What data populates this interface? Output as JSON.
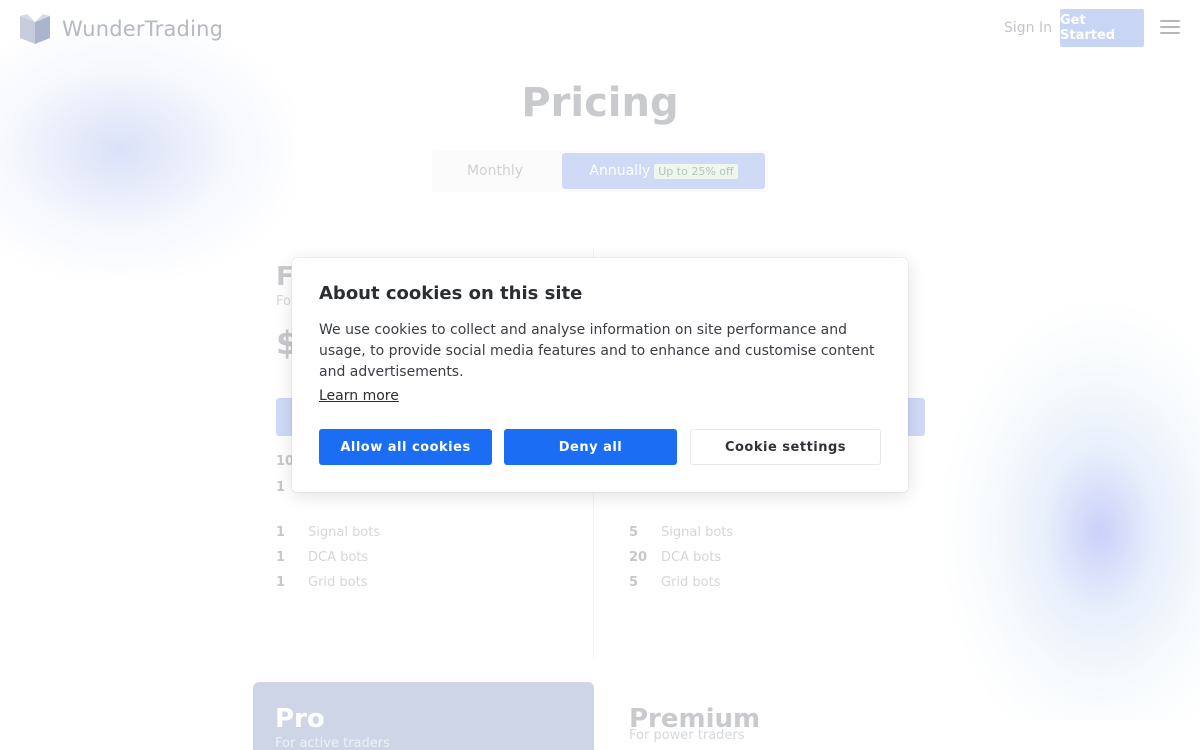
{
  "header": {
    "brand": "WunderTrading",
    "signin_label": "Sign In",
    "get_started_label": "Get Started"
  },
  "pricing": {
    "title": "Pricing",
    "toggle": {
      "monthly_label": "Monthly",
      "annually_label": "Annually",
      "discount_badge": "Up to 25% off",
      "selected": "Annually"
    }
  },
  "plans": {
    "free": {
      "name_partial": "F",
      "subtitle_partial": "Fo",
      "price_partial": "$",
      "features_partial": [
        {
          "count": "10"
        },
        {
          "count": "1"
        }
      ],
      "bots": [
        {
          "count": "1",
          "label": "Signal bots"
        },
        {
          "count": "1",
          "label": "DCA bots"
        },
        {
          "count": "1",
          "label": "Grid bots"
        }
      ]
    },
    "basic": {
      "bots": [
        {
          "count": "5",
          "label": "Signal bots"
        },
        {
          "count": "20",
          "label": "DCA bots"
        },
        {
          "count": "5",
          "label": "Grid bots"
        }
      ]
    },
    "pro": {
      "name": "Pro",
      "subtitle": "For active traders"
    },
    "premium": {
      "name": "Premium",
      "subtitle": "For power traders"
    }
  },
  "cookie_banner": {
    "title": "About cookies on this site",
    "body": "We use cookies to collect and analyse information on site performance and usage, to provide social media features and to enhance and customise content and advertisements.",
    "learn_more": "Learn more",
    "allow_label": "Allow all cookies",
    "deny_label": "Deny all",
    "settings_label": "Cookie settings"
  },
  "colors": {
    "accent": "#1b6ef3",
    "accent_faded": "#cfdaf6"
  },
  "icons": {
    "logo": "wundertrading-logo-icon",
    "menu": "hamburger-menu-icon"
  }
}
